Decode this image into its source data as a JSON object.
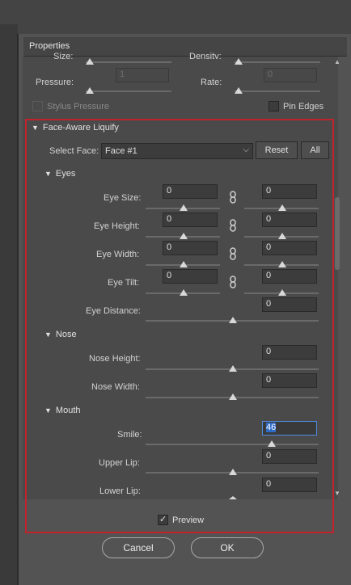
{
  "dialog": {
    "title": "Properties"
  },
  "brush": {
    "size_label": "Size:",
    "density_label": "Density:",
    "pressure_label": "Pressure:",
    "pressure_value": "1",
    "rate_label": "Rate:",
    "rate_value": "0",
    "stylus_pressure_label": "Stylus Pressure",
    "pin_edges_label": "Pin Edges"
  },
  "face_aware": {
    "title": "Face-Aware Liquify",
    "select_face_label": "Select Face:",
    "select_face_value": "Face #1",
    "reset_label": "Reset",
    "all_label": "All"
  },
  "eyes": {
    "title": "Eyes",
    "eye_size_label": "Eye Size:",
    "eye_size_left": "0",
    "eye_size_right": "0",
    "eye_height_label": "Eye Height:",
    "eye_height_left": "0",
    "eye_height_right": "0",
    "eye_width_label": "Eye Width:",
    "eye_width_left": "0",
    "eye_width_right": "0",
    "eye_tilt_label": "Eye Tilt:",
    "eye_tilt_left": "0",
    "eye_tilt_right": "0",
    "eye_distance_label": "Eye Distance:",
    "eye_distance_value": "0"
  },
  "nose": {
    "title": "Nose",
    "nose_height_label": "Nose Height:",
    "nose_height_value": "0",
    "nose_width_label": "Nose Width:",
    "nose_width_value": "0"
  },
  "mouth": {
    "title": "Mouth",
    "smile_label": "Smile:",
    "smile_value": "46",
    "upper_lip_label": "Upper Lip:",
    "upper_lip_value": "0",
    "lower_lip_label": "Lower Lip:",
    "lower_lip_value": "0"
  },
  "footer": {
    "preview_label": "Preview",
    "cancel_label": "Cancel",
    "ok_label": "OK"
  },
  "icons": {
    "collapse": "triangle-down-icon",
    "link": "chain-link-icon",
    "dropdown": "chevron-down-icon",
    "check": "checkmark-icon"
  },
  "colors": {
    "highlight_border": "#c0232b",
    "focus_border": "#4f8cdf",
    "panel_bg": "#4a4a4a"
  }
}
